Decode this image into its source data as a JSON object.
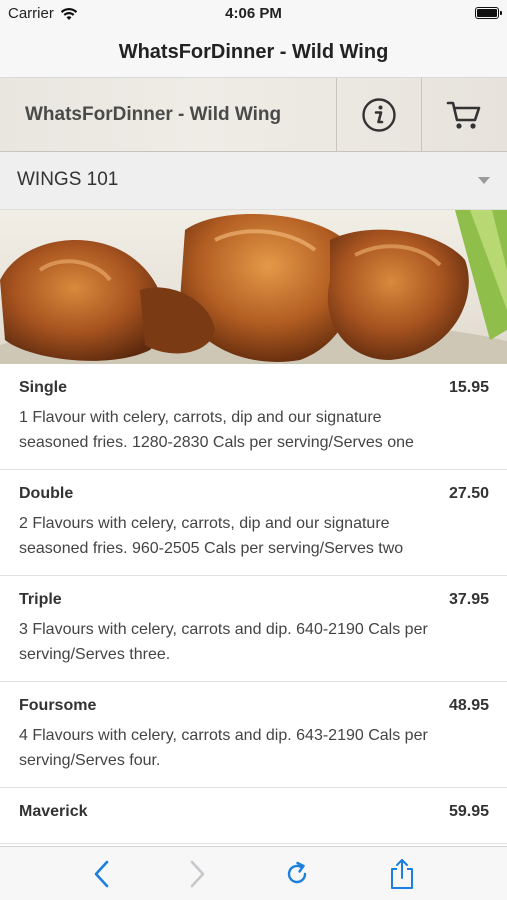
{
  "status_bar": {
    "carrier": "Carrier",
    "time": "4:06 PM"
  },
  "nav": {
    "title": "WhatsForDinner - Wild Wing"
  },
  "app_header": {
    "title": "WhatsForDinner - Wild Wing"
  },
  "section": {
    "title": "WINGS 101"
  },
  "menu_items": [
    {
      "name": "Single",
      "price": "15.95",
      "description": "1 Flavour with celery, carrots, dip and our signature seasoned fries. 1280-2830 Cals per serving/Serves one"
    },
    {
      "name": "Double",
      "price": "27.50",
      "description": "2 Flavours with celery, carrots, dip and our signature seasoned fries. 960-2505 Cals per serving/Serves two"
    },
    {
      "name": "Triple",
      "price": "37.95",
      "description": "3 Flavours with celery, carrots and dip. 640-2190 Cals per serving/Serves three."
    },
    {
      "name": "Foursome",
      "price": "48.95",
      "description": "4 Flavours with celery, carrots and dip. 643-2190 Cals per serving/Serves four."
    },
    {
      "name": "Maverick",
      "price": "59.95",
      "description": ""
    }
  ],
  "colors": {
    "toolbar_accent": "#1a7fe0",
    "toolbar_disabled": "#c7c7cc"
  }
}
